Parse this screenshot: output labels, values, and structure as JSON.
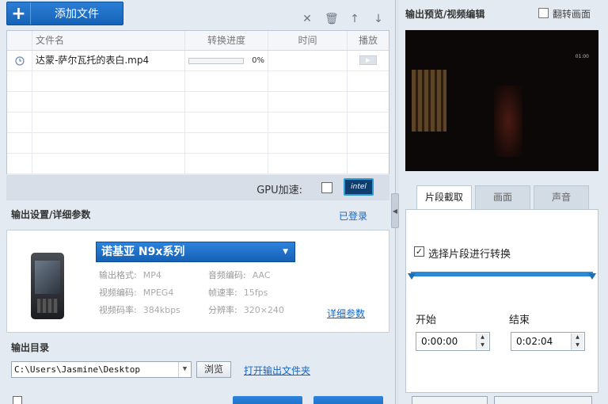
{
  "toolbar": {
    "add_file_label": "添加文件"
  },
  "file_table": {
    "columns": [
      "文件名",
      "转换进度",
      "时间",
      "播放"
    ],
    "rows": [
      {
        "name": "达蒙-萨尔瓦托的表白.mp4",
        "progress": 0,
        "progress_text": "0%",
        "time": ""
      }
    ]
  },
  "gpu": {
    "label": "GPU加速:",
    "checked": false,
    "badge": "intel"
  },
  "output_settings": {
    "title": "输出设置/详细参数",
    "login_link": "已登录",
    "device": "诺基亚 N9x系列",
    "params": [
      {
        "k": "输出格式:",
        "v": "MP4"
      },
      {
        "k": "音频编码:",
        "v": "AAC"
      },
      {
        "k": "视频编码:",
        "v": "MPEG4"
      },
      {
        "k": "帧速率:",
        "v": "15fps"
      },
      {
        "k": "视频码率:",
        "v": "384kbps"
      },
      {
        "k": "分辨率:",
        "v": "320×240"
      }
    ],
    "detail_link": "详细参数"
  },
  "output_dir": {
    "title": "输出目录",
    "path": "C:\\Users\\Jasmine\\Desktop",
    "browse_label": "浏览",
    "open_link": "打开输出文件夹"
  },
  "preview": {
    "title": "输出预览/视频编辑",
    "flip_label": "翻转画面",
    "timestamp": "01:00"
  },
  "edit_tabs": {
    "tabs": [
      "片段截取",
      "画面",
      "声音"
    ],
    "active": 0,
    "clip_label": "选择片段进行转换",
    "clip_checked": true,
    "start_label": "开始",
    "end_label": "结束",
    "start_value": "0:00:00",
    "end_value": "0:02:04"
  }
}
